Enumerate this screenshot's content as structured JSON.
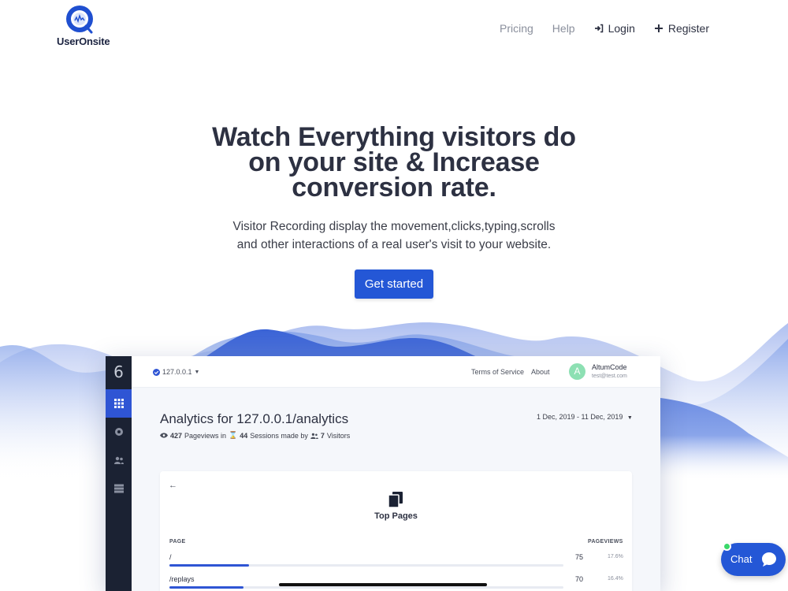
{
  "brand": {
    "name": "UserOnsite"
  },
  "nav": {
    "pricing": "Pricing",
    "help": "Help",
    "login": "Login",
    "register": "Register"
  },
  "hero": {
    "title": "Watch Everything visitors do on your site & Increase conversion rate.",
    "subtitle": "Visitor Recording display the movement,clicks,typing,scrolls and other interactions of a real user's visit to your website.",
    "cta": "Get started"
  },
  "app": {
    "sidebar_brand": "6",
    "site": "127.0.0.1",
    "links": [
      "Terms of Service",
      "About"
    ],
    "user": {
      "initial": "A",
      "name": "AltumCode",
      "email": "test@test.com"
    },
    "title": "Analytics for 127.0.0.1/analytics",
    "stats": {
      "pageviews": "427",
      "pageviews_label": "Pageviews in",
      "sessions": "44",
      "sessions_label": "Sessions made by",
      "visitors": "7",
      "visitors_label": "Visitors"
    },
    "date_range": "1 Dec, 2019 - 11 Dec, 2019",
    "card": {
      "back": "←",
      "title": "Top Pages",
      "col_page": "PAGE",
      "col_views": "PAGEVIEWS",
      "rows": [
        {
          "path": "/",
          "count": "75",
          "pct": "17.6%",
          "fraction": 0.176
        },
        {
          "path": "/replays",
          "count": "70",
          "pct": "16.4%",
          "fraction": 0.164
        }
      ]
    }
  },
  "chat": {
    "label": "Chat"
  },
  "colors": {
    "accent": "#2457d6",
    "sidebar": "#1b2233",
    "online": "#3ad86a"
  }
}
